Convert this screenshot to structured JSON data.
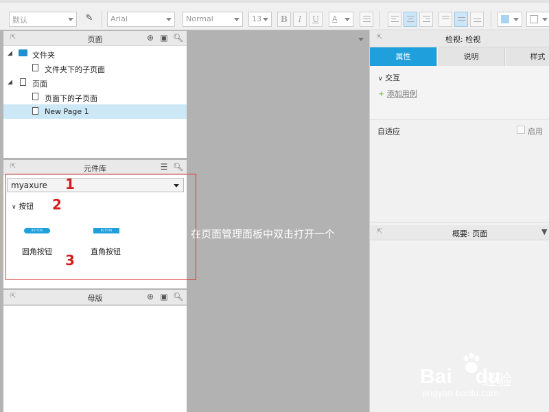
{
  "toolbar": {
    "style_select": "默认",
    "font_select": "Arial",
    "weight_select": "Normal",
    "size_select": "13",
    "bold": "B",
    "italic": "I",
    "underline": "U",
    "font_color": "A"
  },
  "pages_panel": {
    "title": "页面",
    "items": [
      {
        "label": "文件夹",
        "type": "folder"
      },
      {
        "label": "文件夹下的子页面",
        "type": "page"
      },
      {
        "label": "页面",
        "type": "page"
      },
      {
        "label": "页面下的子页面",
        "type": "page"
      },
      {
        "label": "New Page 1",
        "type": "page",
        "selected": true
      }
    ]
  },
  "library_panel": {
    "title": "元件库",
    "selected_library": "myaxure",
    "group_label": "按钮",
    "widgets": [
      {
        "label": "圆角按钮",
        "shape": "rounded"
      },
      {
        "label": "直角按钮",
        "shape": "square"
      }
    ]
  },
  "masters_panel": {
    "title": "母版"
  },
  "annotations": [
    "1",
    "2",
    "3"
  ],
  "canvas": {
    "overlay_text": "在页面管理面板中双击打开一个"
  },
  "inspector": {
    "title": "检视: 检视",
    "tabs": [
      "属性",
      "说明",
      "样式"
    ],
    "active_tab": 0,
    "interaction_label": "交互",
    "add_case_label": "添加用例",
    "adaptive_label": "自适应",
    "enable_label": "启用"
  },
  "summary": {
    "title": "概要: 页面"
  },
  "watermark": {
    "logo": "Bai",
    "logo_suffix": "du",
    "text": "经验",
    "url": "jingyan.baidu.com"
  },
  "colors": {
    "accent": "#1fa0dc",
    "annotation": "#d41e1e",
    "selected_row": "#cce8f6"
  }
}
